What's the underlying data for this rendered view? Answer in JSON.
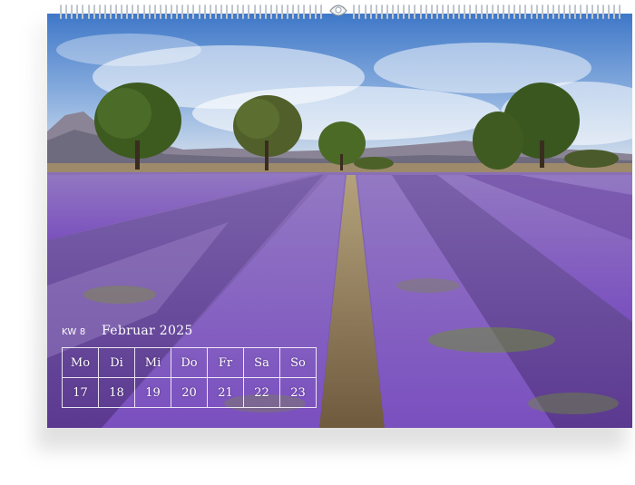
{
  "calendar": {
    "week_label": "KW 8",
    "month_label": "Februar 2025",
    "weekdays": [
      "Mo",
      "Di",
      "Mi",
      "Do",
      "Fr",
      "Sa",
      "So"
    ],
    "days": [
      "17",
      "18",
      "19",
      "20",
      "21",
      "22",
      "23"
    ]
  },
  "colors": {
    "lavender": "#7a55b0",
    "sky": "#6f9bd6",
    "overlay_text": "#ffffff"
  }
}
